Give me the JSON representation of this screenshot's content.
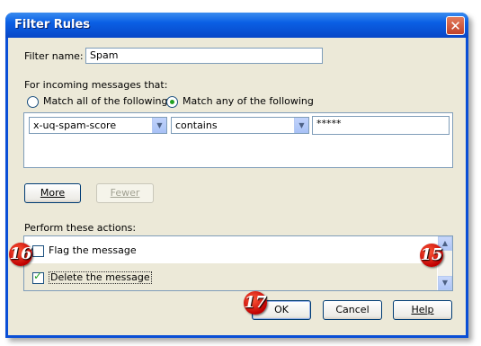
{
  "dialog": {
    "title": "Filter Rules",
    "close_glyph": "✕"
  },
  "filter_name": {
    "label": "Filter name:",
    "value": "Spam"
  },
  "conditions": {
    "heading": "For incoming messages that:",
    "match_all_label": "Match all of the following",
    "match_any_label": "Match any of the following",
    "selected": "any",
    "rule": {
      "field": "x-uq-spam-score",
      "operator": "contains",
      "value": "*****"
    },
    "more_label": "More",
    "fewer_label": "Fewer"
  },
  "actions": {
    "heading": "Perform these actions:",
    "items": [
      {
        "label": "Flag the message",
        "checked": false
      },
      {
        "label": "Delete the message",
        "checked": true
      }
    ]
  },
  "buttons": {
    "ok_label": "OK",
    "cancel_label": "Cancel",
    "help_label": "Help"
  },
  "annotations": {
    "badge_16": "16",
    "badge_15": "15",
    "badge_17": "17"
  }
}
